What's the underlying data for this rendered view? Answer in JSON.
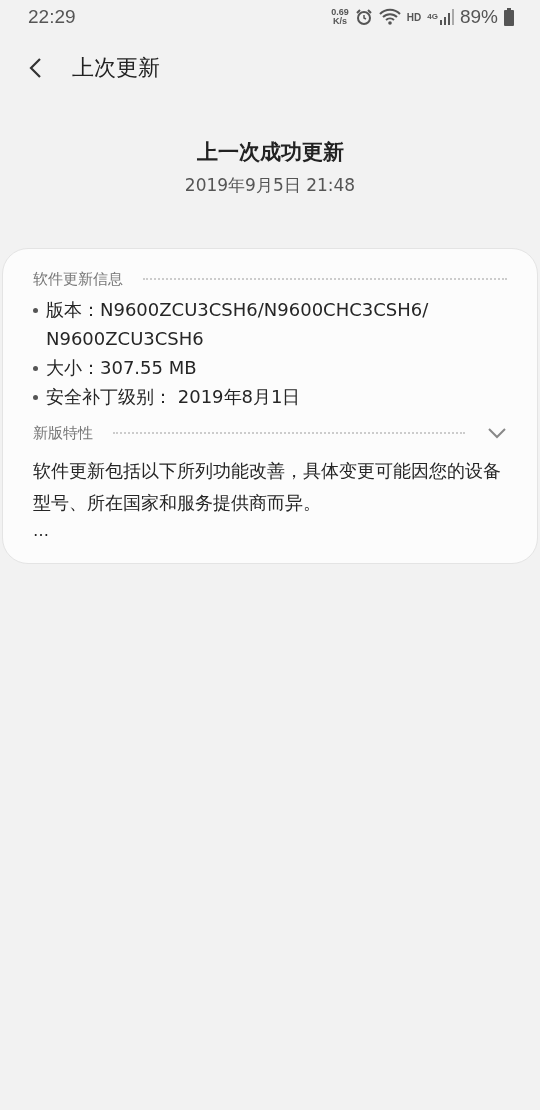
{
  "status_bar": {
    "time": "22:29",
    "net_speed": "0.69",
    "net_unit": "K/s",
    "hd": "HD",
    "network": "4G",
    "battery": "89%"
  },
  "header": {
    "title": "上次更新"
  },
  "summary": {
    "title": "上一次成功更新",
    "date": "2019年9月5日 21:48"
  },
  "info_section": {
    "title": "软件更新信息",
    "items": [
      {
        "text": "版本：N9600ZCU3CSH6/N9600CHC3CSH6/ N9600ZCU3CSH6"
      },
      {
        "text": "大小：307.55 MB"
      },
      {
        "text": "安全补丁级别： 2019年8月1日"
      }
    ]
  },
  "features_section": {
    "title": "新版特性",
    "expanded": false,
    "text": "软件更新包括以下所列功能改善，具体变更可能因您的设备型号、所在国家和服务提供商而异。",
    "more": "…"
  }
}
